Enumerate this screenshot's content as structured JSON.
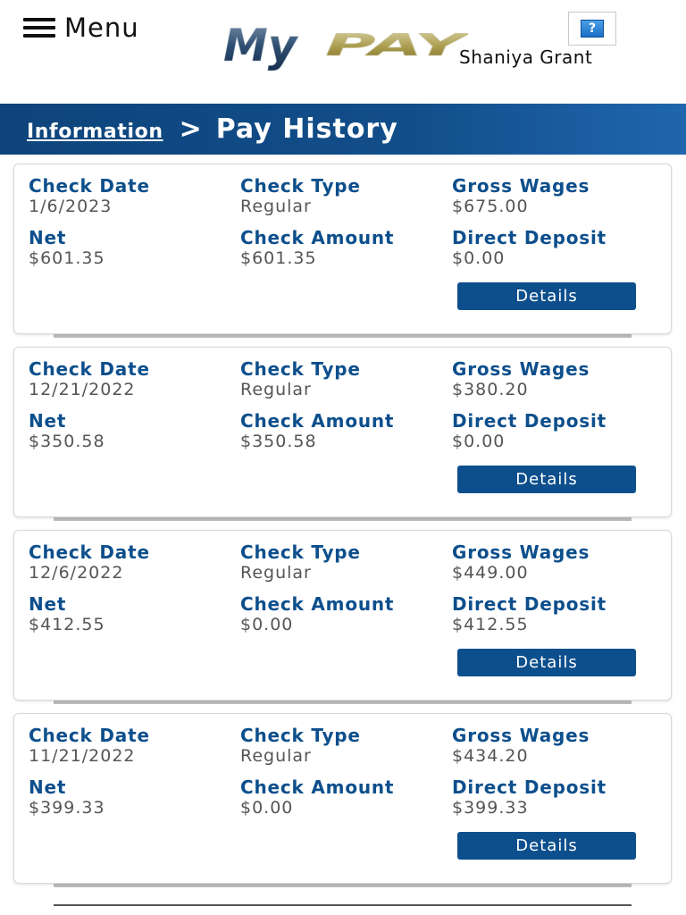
{
  "header": {
    "menu_label": "Menu",
    "logo_text_my": "My",
    "logo_text_pay": "PAY",
    "user_name": "Shaniya Grant",
    "help_label": "?"
  },
  "title_bar": {
    "breadcrumb_link": "Information",
    "separator": ">",
    "page_title": "Pay History"
  },
  "labels": {
    "check_date": "Check Date",
    "check_type": "Check Type",
    "gross_wages": "Gross Wages",
    "net": "Net",
    "check_amount": "Check Amount",
    "direct_deposit": "Direct Deposit",
    "details_button": "Details"
  },
  "checks": [
    {
      "check_date": "1/6/2023",
      "check_type": "Regular",
      "gross_wages": "$675.00",
      "net": "$601.35",
      "check_amount": "$601.35",
      "direct_deposit": "$0.00"
    },
    {
      "check_date": "12/21/2022",
      "check_type": "Regular",
      "gross_wages": "$380.20",
      "net": "$350.58",
      "check_amount": "$350.58",
      "direct_deposit": "$0.00"
    },
    {
      "check_date": "12/6/2022",
      "check_type": "Regular",
      "gross_wages": "$449.00",
      "net": "$412.55",
      "check_amount": "$0.00",
      "direct_deposit": "$412.55"
    },
    {
      "check_date": "11/21/2022",
      "check_type": "Regular",
      "gross_wages": "$434.20",
      "net": "$399.33",
      "check_amount": "$0.00",
      "direct_deposit": "$399.33"
    }
  ],
  "colors": {
    "brand_blue": "#0d4f8c",
    "title_bar_dark": "#0d447b",
    "title_bar_light": "#1f66ad",
    "value_gray": "#555555",
    "logo_gold": "#b3a55a"
  },
  "icons": {
    "menu": "hamburger-icon",
    "help": "help-icon"
  }
}
